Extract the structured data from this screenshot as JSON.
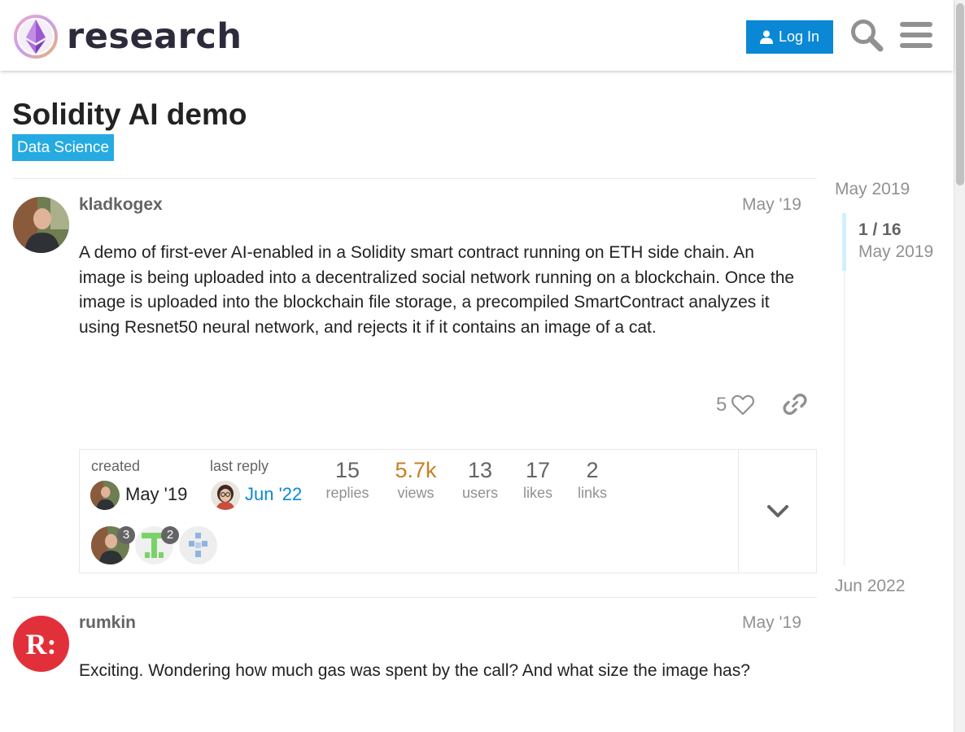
{
  "header": {
    "logo_text": "research",
    "login_label": "Log In"
  },
  "topic": {
    "title": "Solidity AI demo",
    "category": "Data Science",
    "category_color": "#25aae1"
  },
  "posts": [
    {
      "username": "kladkogex",
      "date": "May '19",
      "body": "A demo of first-ever AI-enabled in a Solidity smart contract running on ETH side chain. An image is being uploaded into a decentralized social network running on a blockchain. Once the image is uploaded into the blockchain file storage, a precompiled SmartContract analyzes it using Resnet50 neural network, and rejects it if it contains an image of a cat.",
      "likes": "5"
    },
    {
      "username": "rumkin",
      "date": "May '19",
      "body": "Exciting. Wondering how much gas was spent by the call? And what size the image has?",
      "avatar_text": "R:"
    }
  ],
  "topic_map": {
    "created_label": "created",
    "created_date": "May '19",
    "last_reply_label": "last reply",
    "last_reply_date": "Jun '22",
    "stats": [
      {
        "num": "15",
        "label": "replies"
      },
      {
        "num": "5.7k",
        "label": "views"
      },
      {
        "num": "13",
        "label": "users"
      },
      {
        "num": "17",
        "label": "likes"
      },
      {
        "num": "2",
        "label": "links"
      }
    ],
    "participants": [
      {
        "count": "3"
      },
      {
        "count": "2"
      },
      {
        "count": ""
      }
    ]
  },
  "timeline": {
    "start": "May 2019",
    "position": "1 / 16",
    "position_date": "May 2019",
    "end": "Jun 2022"
  },
  "colors": {
    "accent": "#0a88d6",
    "views_highlight": "#c97f24",
    "last_reply_link": "#0a88d6"
  }
}
